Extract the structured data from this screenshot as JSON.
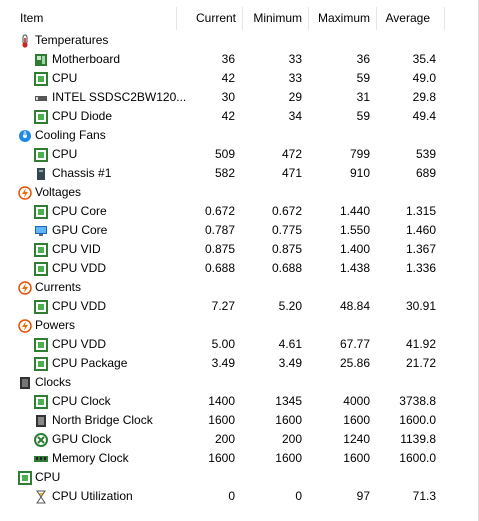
{
  "columns": [
    "Item",
    "Current",
    "Minimum",
    "Maximum",
    "Average"
  ],
  "groups": [
    {
      "label": "Temperatures",
      "icon": "thermometer-icon",
      "rows": [
        {
          "label": "Motherboard",
          "icon": "motherboard-icon",
          "cur": "36",
          "min": "33",
          "max": "36",
          "avg": "35.4"
        },
        {
          "label": "CPU",
          "icon": "cpu-chip-icon",
          "cur": "42",
          "min": "33",
          "max": "59",
          "avg": "49.0"
        },
        {
          "label": "INTEL SSDSC2BW120...",
          "icon": "ssd-drive-icon",
          "cur": "30",
          "min": "29",
          "max": "31",
          "avg": "29.8"
        },
        {
          "label": "CPU Diode",
          "icon": "cpu-chip-icon",
          "cur": "42",
          "min": "34",
          "max": "59",
          "avg": "49.4"
        }
      ]
    },
    {
      "label": "Cooling Fans",
      "icon": "fan-icon",
      "rows": [
        {
          "label": "CPU",
          "icon": "cpu-chip-icon",
          "cur": "509",
          "min": "472",
          "max": "799",
          "avg": "539"
        },
        {
          "label": "Chassis #1",
          "icon": "chassis-icon",
          "cur": "582",
          "min": "471",
          "max": "910",
          "avg": "689"
        }
      ]
    },
    {
      "label": "Voltages",
      "icon": "voltage-icon",
      "rows": [
        {
          "label": "CPU Core",
          "icon": "cpu-chip-icon",
          "cur": "0.672",
          "min": "0.672",
          "max": "1.440",
          "avg": "1.315"
        },
        {
          "label": "GPU Core",
          "icon": "gpu-monitor-icon",
          "cur": "0.787",
          "min": "0.775",
          "max": "1.550",
          "avg": "1.460"
        },
        {
          "label": "CPU VID",
          "icon": "cpu-chip-icon",
          "cur": "0.875",
          "min": "0.875",
          "max": "1.400",
          "avg": "1.367"
        },
        {
          "label": "CPU VDD",
          "icon": "cpu-chip-icon",
          "cur": "0.688",
          "min": "0.688",
          "max": "1.438",
          "avg": "1.336"
        }
      ]
    },
    {
      "label": "Currents",
      "icon": "current-icon",
      "rows": [
        {
          "label": "CPU VDD",
          "icon": "cpu-chip-icon",
          "cur": "7.27",
          "min": "5.20",
          "max": "48.84",
          "avg": "30.91"
        }
      ]
    },
    {
      "label": "Powers",
      "icon": "power-icon",
      "rows": [
        {
          "label": "CPU VDD",
          "icon": "cpu-chip-icon",
          "cur": "5.00",
          "min": "4.61",
          "max": "67.77",
          "avg": "41.92"
        },
        {
          "label": "CPU Package",
          "icon": "cpu-chip-icon",
          "cur": "3.49",
          "min": "3.49",
          "max": "25.86",
          "avg": "21.72"
        }
      ]
    },
    {
      "label": "Clocks",
      "icon": "clock-chip-icon",
      "rows": [
        {
          "label": "CPU Clock",
          "icon": "cpu-chip-icon",
          "cur": "1400",
          "min": "1345",
          "max": "4000",
          "avg": "3738.8"
        },
        {
          "label": "North Bridge Clock",
          "icon": "chip-icon",
          "cur": "1600",
          "min": "1600",
          "max": "1600",
          "avg": "1600.0"
        },
        {
          "label": "GPU Clock",
          "icon": "xbox-gpu-icon",
          "cur": "200",
          "min": "200",
          "max": "1240",
          "avg": "1139.8"
        },
        {
          "label": "Memory Clock",
          "icon": "memory-icon",
          "cur": "1600",
          "min": "1600",
          "max": "1600",
          "avg": "1600.0"
        }
      ]
    },
    {
      "label": "CPU",
      "icon": "cpu-chip-icon",
      "rows": [
        {
          "label": "CPU Utilization",
          "icon": "hourglass-icon",
          "cur": "0",
          "min": "0",
          "max": "97",
          "avg": "71.3"
        }
      ]
    }
  ]
}
